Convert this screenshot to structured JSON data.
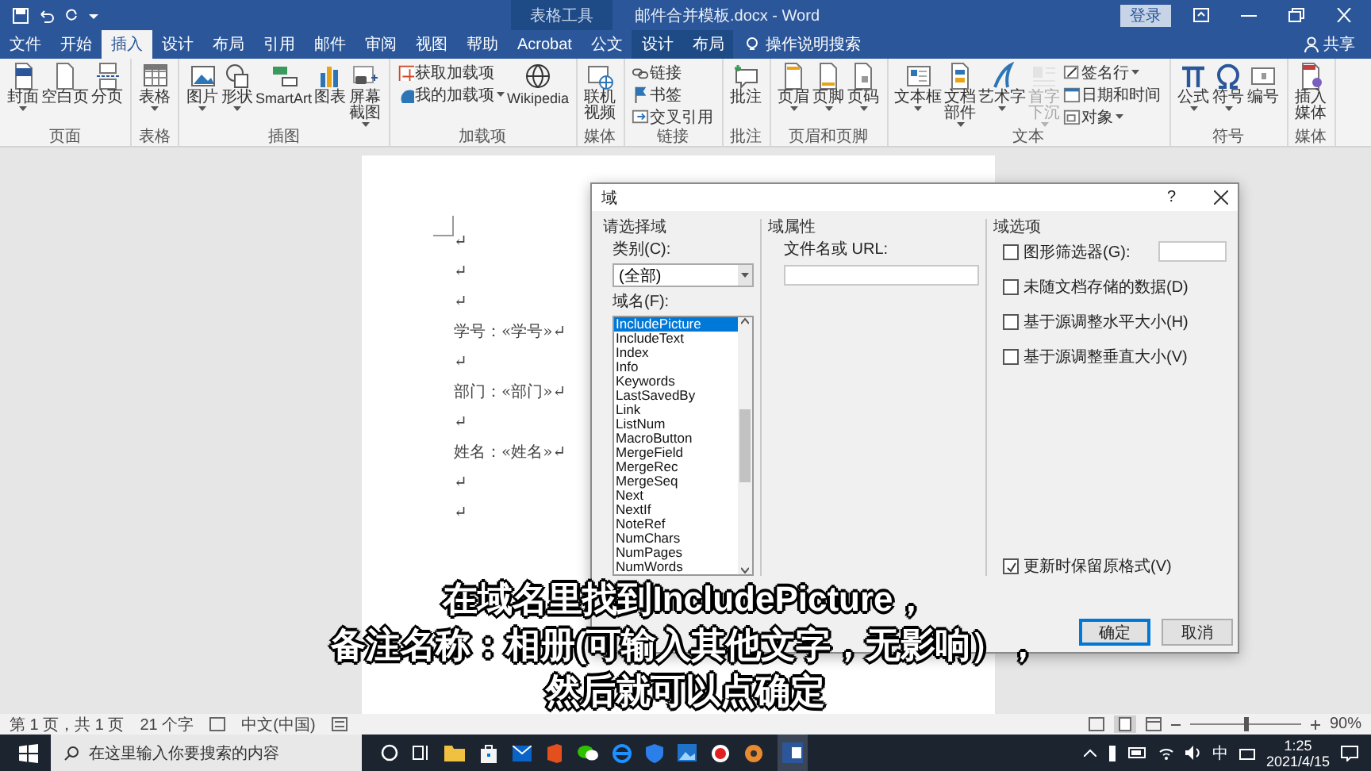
{
  "title_bar": {
    "context_group": "表格工具",
    "title": "邮件合并模板.docx - Word",
    "login": "登录"
  },
  "tabs": [
    {
      "label": "文件",
      "kind": "main",
      "selected": false
    },
    {
      "label": "开始",
      "kind": "main",
      "selected": false
    },
    {
      "label": "插入",
      "kind": "main",
      "selected": true
    },
    {
      "label": "设计",
      "kind": "main",
      "selected": false
    },
    {
      "label": "布局",
      "kind": "main",
      "selected": false
    },
    {
      "label": "引用",
      "kind": "main",
      "selected": false
    },
    {
      "label": "邮件",
      "kind": "main",
      "selected": false
    },
    {
      "label": "审阅",
      "kind": "main",
      "selected": false
    },
    {
      "label": "视图",
      "kind": "main",
      "selected": false
    },
    {
      "label": "帮助",
      "kind": "main",
      "selected": false
    },
    {
      "label": "Acrobat",
      "kind": "main",
      "selected": false
    },
    {
      "label": "公文",
      "kind": "main",
      "selected": false
    },
    {
      "label": "设计",
      "kind": "context",
      "selected": false
    },
    {
      "label": "布局",
      "kind": "context",
      "selected": false
    }
  ],
  "tell_me": "操作说明搜索",
  "share": "共享",
  "ribbon": {
    "groups": [
      {
        "label": "页面",
        "items": [
          {
            "kind": "large",
            "label": "封面",
            "dropdown": true,
            "disabled": false
          },
          {
            "kind": "large",
            "label": "空白页",
            "dropdown": false,
            "disabled": false
          },
          {
            "kind": "large",
            "label": "分页",
            "dropdown": false,
            "disabled": false
          }
        ]
      },
      {
        "label": "表格",
        "items": [
          {
            "kind": "large",
            "label": "表格",
            "dropdown": true,
            "disabled": false
          }
        ]
      },
      {
        "label": "插图",
        "items": [
          {
            "kind": "large",
            "label": "图片",
            "dropdown": true,
            "disabled": false
          },
          {
            "kind": "large",
            "label": "形状",
            "dropdown": true,
            "disabled": false
          },
          {
            "kind": "large",
            "label": "SmartArt",
            "dropdown": false,
            "disabled": false
          },
          {
            "kind": "large",
            "label": "图表",
            "dropdown": false,
            "disabled": false
          },
          {
            "kind": "large",
            "label": "屏幕截图",
            "dropdown": true,
            "disabled": false
          }
        ]
      },
      {
        "label": "加载项",
        "items": [
          {
            "kind": "small",
            "label": "获取加载项",
            "dropdown": false,
            "disabled": false
          },
          {
            "kind": "small",
            "label": "我的加载项",
            "dropdown": true,
            "disabled": false
          },
          {
            "kind": "large",
            "label": "Wikipedia",
            "dropdown": false,
            "disabled": false
          }
        ]
      },
      {
        "label": "媒体",
        "items": [
          {
            "kind": "large",
            "label": "联机视频",
            "dropdown": false,
            "disabled": false
          }
        ]
      },
      {
        "label": "链接",
        "items": [
          {
            "kind": "small",
            "label": "链接",
            "dropdown": false,
            "disabled": false
          },
          {
            "kind": "small",
            "label": "书签",
            "dropdown": false,
            "disabled": false
          },
          {
            "kind": "small",
            "label": "交叉引用",
            "dropdown": false,
            "disabled": false
          }
        ]
      },
      {
        "label": "批注",
        "items": [
          {
            "kind": "large",
            "label": "批注",
            "dropdown": false,
            "disabled": false
          }
        ]
      },
      {
        "label": "页眉和页脚",
        "items": [
          {
            "kind": "large",
            "label": "页眉",
            "dropdown": true,
            "disabled": false
          },
          {
            "kind": "large",
            "label": "页脚",
            "dropdown": true,
            "disabled": false
          },
          {
            "kind": "large",
            "label": "页码",
            "dropdown": true,
            "disabled": false
          }
        ]
      },
      {
        "label": "文本",
        "items": [
          {
            "kind": "large",
            "label": "文本框",
            "dropdown": true,
            "disabled": false
          },
          {
            "kind": "large",
            "label": "文档部件",
            "dropdown": true,
            "disabled": false
          },
          {
            "kind": "large",
            "label": "艺术字",
            "dropdown": true,
            "disabled": false
          },
          {
            "kind": "large",
            "label": "首字下沉",
            "dropdown": true,
            "disabled": true
          },
          {
            "kind": "small",
            "label": "签名行",
            "dropdown": true,
            "disabled": false
          },
          {
            "kind": "small",
            "label": "日期和时间",
            "dropdown": false,
            "disabled": false
          },
          {
            "kind": "small",
            "label": "对象",
            "dropdown": true,
            "disabled": false
          }
        ]
      },
      {
        "label": "符号",
        "items": [
          {
            "kind": "large",
            "label": "公式",
            "dropdown": true,
            "disabled": false
          },
          {
            "kind": "large",
            "label": "符号",
            "dropdown": true,
            "disabled": false
          },
          {
            "kind": "large",
            "label": "编号",
            "dropdown": false,
            "disabled": false
          }
        ]
      },
      {
        "label": "媒体",
        "items": [
          {
            "kind": "large",
            "label": "插入媒体",
            "dropdown": false,
            "disabled": false
          }
        ]
      }
    ]
  },
  "document": {
    "lines": [
      "↵",
      "↵",
      "↵",
      "学号：«学号»↵",
      "↵",
      "部门：«部门»↵",
      "↵",
      "姓名：«姓名»↵",
      "↵",
      "↵"
    ]
  },
  "dialog": {
    "title": "域",
    "help": "?",
    "choose": {
      "heading": "请选择域",
      "category_label": "类别(C):",
      "category_value": "(全部)",
      "names_label": "域名(F):",
      "names": [
        {
          "label": "IncludePicture",
          "selected": true
        },
        {
          "label": "IncludeText",
          "selected": false
        },
        {
          "label": "Index",
          "selected": false
        },
        {
          "label": "Info",
          "selected": false
        },
        {
          "label": "Keywords",
          "selected": false
        },
        {
          "label": "LastSavedBy",
          "selected": false
        },
        {
          "label": "Link",
          "selected": false
        },
        {
          "label": "ListNum",
          "selected": false
        },
        {
          "label": "MacroButton",
          "selected": false
        },
        {
          "label": "MergeField",
          "selected": false
        },
        {
          "label": "MergeRec",
          "selected": false
        },
        {
          "label": "MergeSeq",
          "selected": false
        },
        {
          "label": "Next",
          "selected": false
        },
        {
          "label": "NextIf",
          "selected": false
        },
        {
          "label": "NoteRef",
          "selected": false
        },
        {
          "label": "NumChars",
          "selected": false
        },
        {
          "label": "NumPages",
          "selected": false
        },
        {
          "label": "NumWords",
          "selected": false
        }
      ]
    },
    "properties": {
      "heading": "域属性",
      "url_label": "文件名或 URL:"
    },
    "options": {
      "heading": "域选项",
      "checkboxes": [
        {
          "label": "图形筛选器(G):",
          "checked": false,
          "has_input": true
        },
        {
          "label": "未随文档存储的数据(D)",
          "checked": false,
          "has_input": false
        },
        {
          "label": "基于源调整水平大小(H)",
          "checked": false,
          "has_input": false
        },
        {
          "label": "基于源调整垂直大小(V)",
          "checked": false,
          "has_input": false
        }
      ],
      "preserve": {
        "label": "更新时保留原格式(V)",
        "checked": true
      }
    },
    "buttons": [
      {
        "label": "确定",
        "default": true
      },
      {
        "label": "取消",
        "default": false
      }
    ]
  },
  "subtitle": [
    "在域名里找到IncludePicture，",
    "备注名称：相册(可输入其他文字，无影响），",
    "然后就可以点确定"
  ],
  "status_bar": {
    "page": "第 1 页，共 1 页",
    "words": "21 个字",
    "language": "中文(中国)",
    "zoom": "90%",
    "zoom_slider": {
      "level": 0.5
    }
  },
  "taskbar": {
    "search_placeholder": "在这里输入你要搜索的内容",
    "ime": "中",
    "time": "1:25",
    "date": "2021/4/15"
  }
}
